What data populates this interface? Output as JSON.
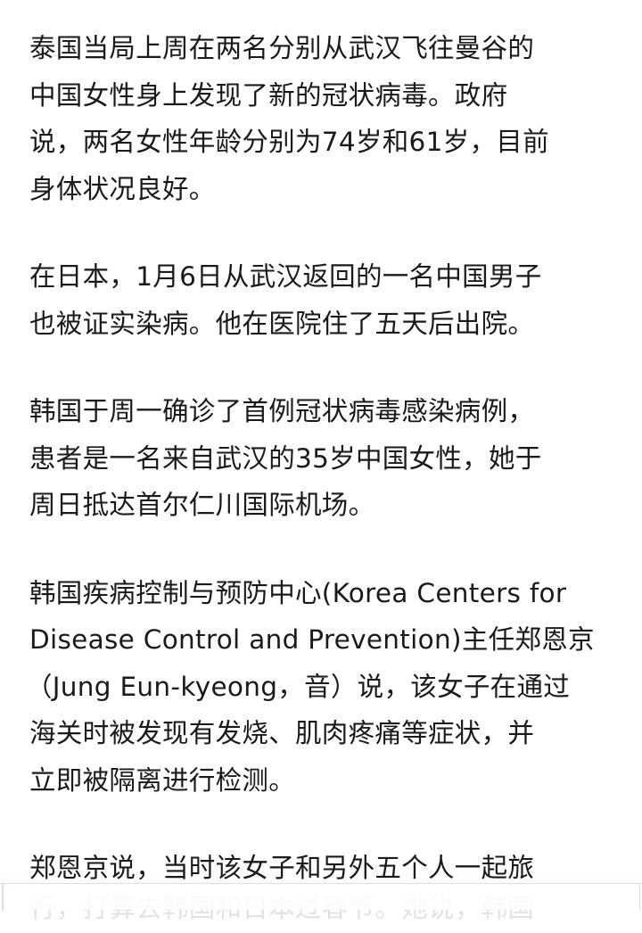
{
  "article": {
    "paragraphs": [
      {
        "lines": [
          "泰国当局上周在两名分别从武汉飞往曼谷的",
          "中国女性身上发现了新的冠状病毒。政府",
          "说，两名女性年龄分别为74岁和61岁，目前",
          "身体状况良好。"
        ]
      },
      {
        "lines": [
          "在日本，1月6日从武汉返回的一名中国男子",
          "也被证实染病。他在医院住了五天后出院。"
        ]
      },
      {
        "lines": [
          "韩国于周一确诊了首例冠状病毒感染病例，",
          "患者是一名来自武汉的35岁中国女性，她于",
          "周日抵达首尔仁川国际机场。"
        ]
      },
      {
        "lines": [
          "韩国疾病控制与预防中心(Korea Centers for",
          "Disease Control and Prevention)主任郑恩京",
          "（Jung Eun-kyeong，音）说，该女子在通过",
          "海关时被发现有发烧、肌肉疼痛等症状，并",
          "立即被隔离进行检测。"
        ]
      },
      {
        "lines": [
          "郑恩京说，当时该女子和另外五个人一起旅"
        ]
      }
    ],
    "partial_next_line": "行，打算去韩国和日本过春节。她说，韩国"
  }
}
